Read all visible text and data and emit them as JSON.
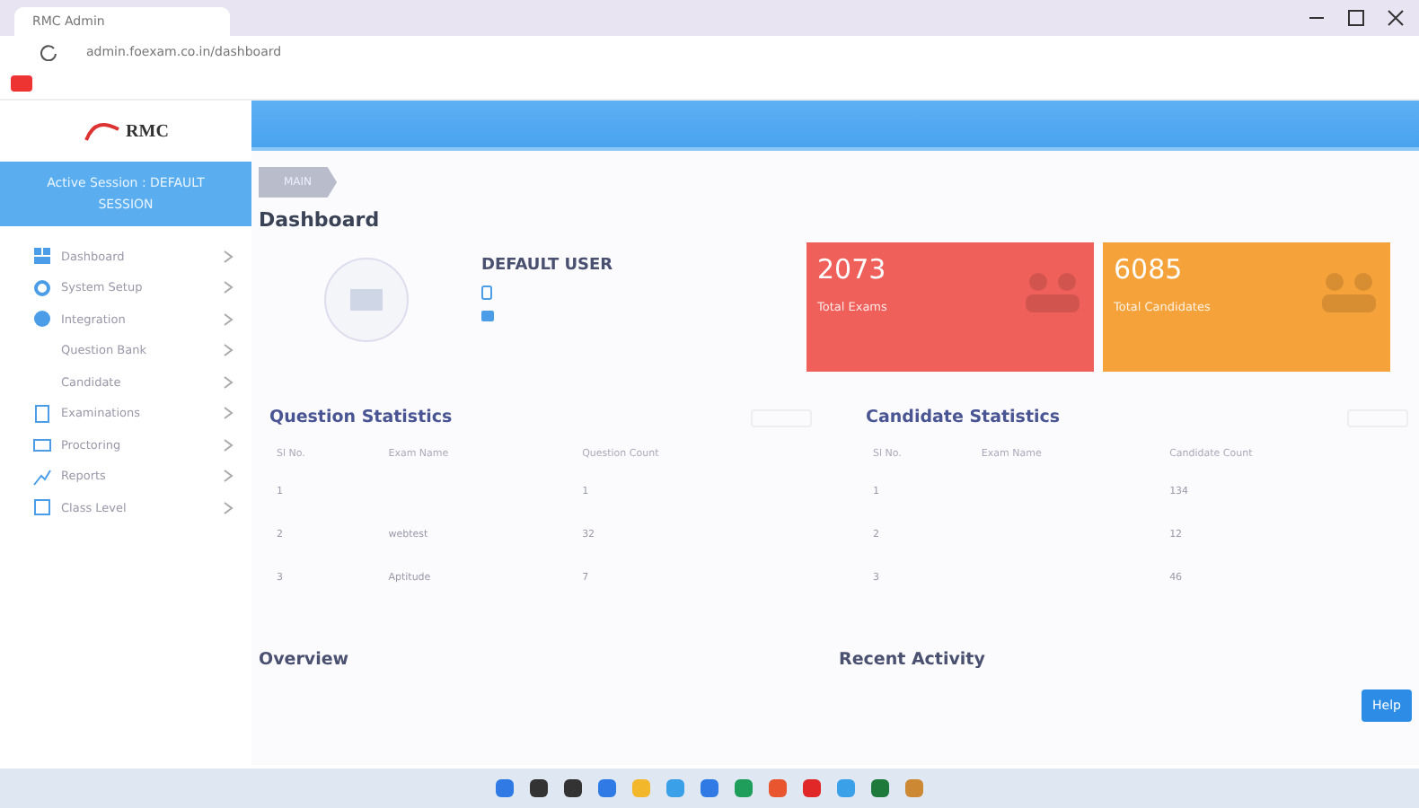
{
  "browser": {
    "tab_title": "RMC Admin",
    "url": "admin.foexam.co.in/dashboard"
  },
  "logo": "RMC",
  "session": "Active Session : DEFAULT SESSION",
  "sidebar": {
    "items": [
      {
        "label": "Dashboard",
        "kind": "grid"
      },
      {
        "label": "System Setup",
        "kind": "gear"
      },
      {
        "label": "Integration",
        "kind": "link"
      },
      {
        "label": "Question Bank",
        "kind": "plain"
      },
      {
        "label": "Candidate",
        "kind": "plain"
      },
      {
        "label": "Examinations",
        "kind": "doc"
      },
      {
        "label": "Proctoring",
        "kind": "cam"
      },
      {
        "label": "Reports",
        "kind": "chart"
      },
      {
        "label": "Class Level",
        "kind": "box"
      }
    ]
  },
  "breadcrumb": "MAIN",
  "page_title": "Dashboard",
  "user": {
    "name": "DEFAULT USER"
  },
  "stats": [
    {
      "value": "2073",
      "label": "Total Exams",
      "color": "#f0605a"
    },
    {
      "value": "6085",
      "label": "Total Candidates",
      "color": "#f5a23a"
    }
  ],
  "panels": [
    {
      "title": "Question Statistics",
      "columns": [
        "Sl No.",
        "Exam Name",
        "Question Count"
      ],
      "rows": [
        [
          "1",
          "",
          "1"
        ],
        [
          "2",
          "webtest",
          "32"
        ],
        [
          "3",
          "Aptitude",
          "7"
        ]
      ]
    },
    {
      "title": "Candidate Statistics",
      "columns": [
        "Sl No.",
        "Exam Name",
        "Candidate Count"
      ],
      "rows": [
        [
          "1",
          "",
          "134"
        ],
        [
          "2",
          "",
          "12"
        ],
        [
          "3",
          "",
          "46"
        ]
      ]
    }
  ],
  "sections": [
    "Overview",
    "Recent Activity"
  ],
  "help": "Help"
}
